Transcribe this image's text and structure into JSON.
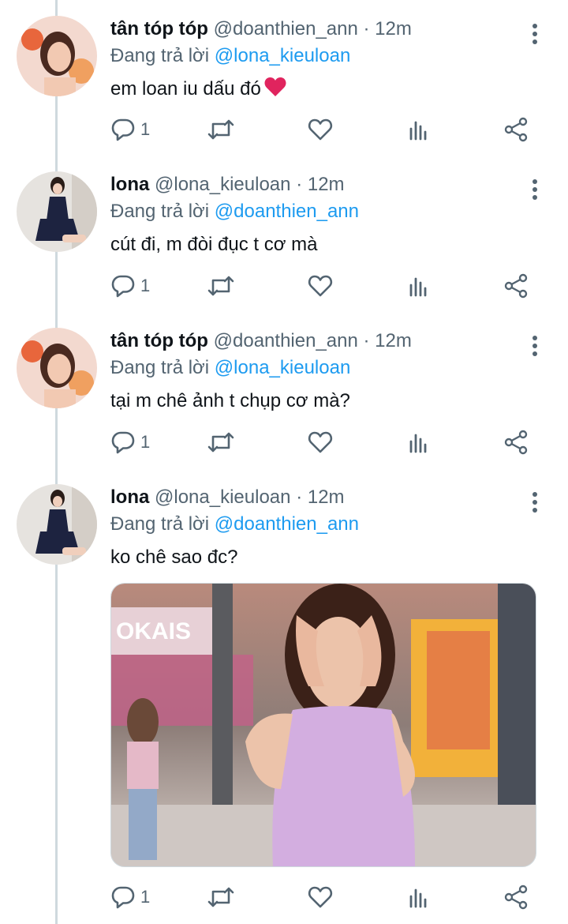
{
  "tweets": [
    {
      "name": "tân tóp tóp",
      "handle": "@doanthien_ann",
      "time": "12m",
      "replying_prefix": "Đang trả lời",
      "replying_to": "@lona_kieuloan",
      "text": "em loan iu dấu đó",
      "reply_count": "1",
      "avatar_icon": "avatar-tan-top-top"
    },
    {
      "name": "lona",
      "handle": "@lona_kieuloan",
      "time": "12m",
      "replying_prefix": "Đang trả lời",
      "replying_to": "@doanthien_ann",
      "text": "cút đi, m đòi đục t cơ mà",
      "reply_count": "1",
      "avatar_icon": "avatar-lona"
    },
    {
      "name": "tân tóp tóp",
      "handle": "@doanthien_ann",
      "time": "12m",
      "replying_prefix": "Đang trả lời",
      "replying_to": "@lona_kieuloan",
      "text": "tại m chê ảnh t chụp cơ mà?",
      "reply_count": "1",
      "avatar_icon": "avatar-tan-top-top"
    },
    {
      "name": "lona",
      "handle": "@lona_kieuloan",
      "time": "12m",
      "replying_prefix": "Đang trả lời",
      "replying_to": "@doanthien_ann",
      "text": "ko chê sao đc?",
      "reply_count": "1",
      "avatar_icon": "avatar-lona",
      "media_sign_text": "OKAIS"
    }
  ],
  "separator": "·",
  "colors": {
    "accent": "#1d9bf0",
    "secondary_text": "#536471",
    "thread_line": "#cfd9de",
    "heart_emoji": "#e0245e"
  }
}
